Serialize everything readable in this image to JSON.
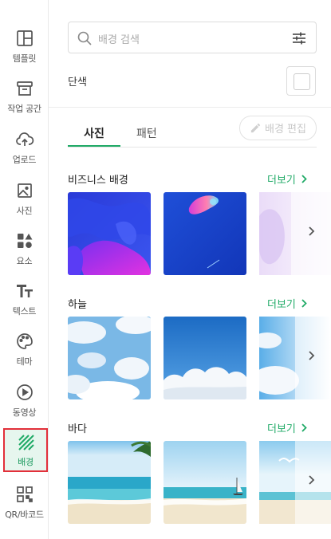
{
  "sidebar": {
    "items": [
      {
        "label": "템플릿",
        "icon": "layout-icon"
      },
      {
        "label": "작업 공간",
        "icon": "archive-icon"
      },
      {
        "label": "업로드",
        "icon": "cloud-upload-icon"
      },
      {
        "label": "사진",
        "icon": "image-icon"
      },
      {
        "label": "요소",
        "icon": "shapes-icon"
      },
      {
        "label": "텍스트",
        "icon": "text-icon"
      },
      {
        "label": "테마",
        "icon": "palette-icon"
      },
      {
        "label": "동영상",
        "icon": "play-circle-icon"
      },
      {
        "label": "배경",
        "icon": "background-pattern-icon",
        "active": true
      },
      {
        "label": "QR/바코드",
        "icon": "qr-code-icon"
      }
    ]
  },
  "search": {
    "placeholder": "배경 검색"
  },
  "solid": {
    "label": "단색",
    "color": "#ffffff"
  },
  "tabs": [
    {
      "label": "사진",
      "active": true
    },
    {
      "label": "패턴"
    }
  ],
  "edit_button": {
    "label": "배경 편집"
  },
  "sections": [
    {
      "title": "비즈니스 배경",
      "more": "더보기"
    },
    {
      "title": "하늘",
      "more": "더보기"
    },
    {
      "title": "바다",
      "more": "더보기"
    }
  ],
  "colors": {
    "accent": "#1faa66",
    "active_bg": "#e6f6ee",
    "highlight_border": "#e2303a"
  }
}
